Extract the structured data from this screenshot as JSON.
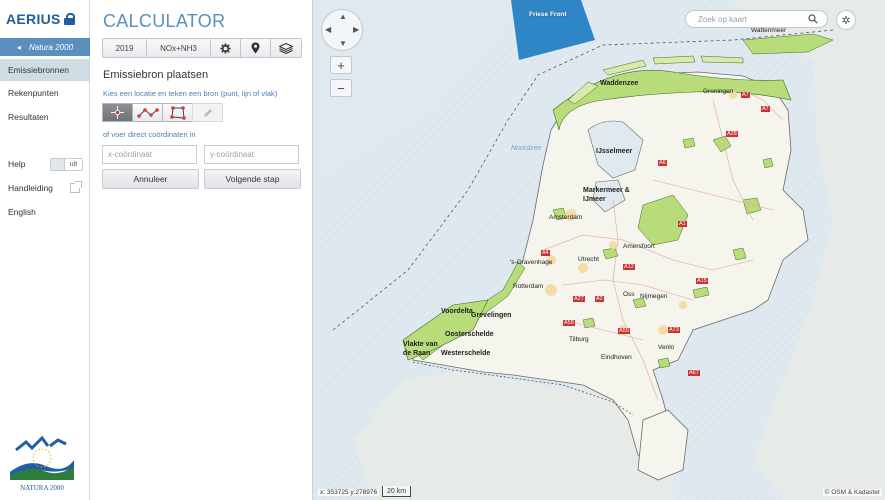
{
  "nav": {
    "brand": "AERIUS",
    "theme_label": "Natura 2000",
    "items": [
      {
        "label": "Emissiebronnen"
      },
      {
        "label": "Rekenpunten"
      },
      {
        "label": "Resultaten"
      }
    ],
    "help_label": "Help",
    "help_toggle": "uit",
    "manual_label": "Handleiding",
    "language_label": "English",
    "natura_text": "NATURA 2000"
  },
  "panel": {
    "title": "CALCULATOR",
    "toolbar": {
      "year": "2019",
      "substance": "NOx+NH3"
    },
    "subtitle": "Emissiebron plaatsen",
    "instruction": "Kies een locatie en teken een bron (punt, lijn of vlak)",
    "or_text": "of voer direct coördinaten in",
    "x_placeholder": "x-coördinaat",
    "y_placeholder": "y-coördinaat",
    "cancel": "Annuleer",
    "next": "Volgende stap"
  },
  "map": {
    "search_placeholder": "Zoek op kaart",
    "coords": "x: 353725 y:278976",
    "scale": "20 km",
    "attribution": "© OSM & Kadaster",
    "labels": {
      "friese_front": "Friese Front",
      "waddenzee": "Waddenzee",
      "wattenmeer": "Wattenmeer",
      "groningen": "Groningen",
      "ijsselmeer": "IJsselmeer",
      "markermeer": "Markermeer & IJmeer",
      "noordzee": "Noordzee",
      "amsterdam": "Amsterdam",
      "amersfoort": "Amersfoort",
      "den_haag": "'s-Gravenhage",
      "utrecht": "Utrecht",
      "rotterdam": "Rotterdam",
      "oss": "Oss",
      "nijmegen": "Nijmegen",
      "voordelta": "Voordelta",
      "grevelingen": "Grevelingen",
      "oosterschelde": "Oosterschelde",
      "westerschelde": "Westerschelde",
      "vlakte": "Vlakte van de Raan",
      "tilburg": "Tilburg",
      "eindhoven": "Eindhoven",
      "venlo": "Venlo",
      "roads": [
        "A7",
        "A28",
        "A1",
        "A12",
        "A2",
        "A50",
        "A73",
        "A15",
        "A67",
        "A58",
        "A4",
        "A27",
        "A6",
        "A7"
      ]
    }
  }
}
